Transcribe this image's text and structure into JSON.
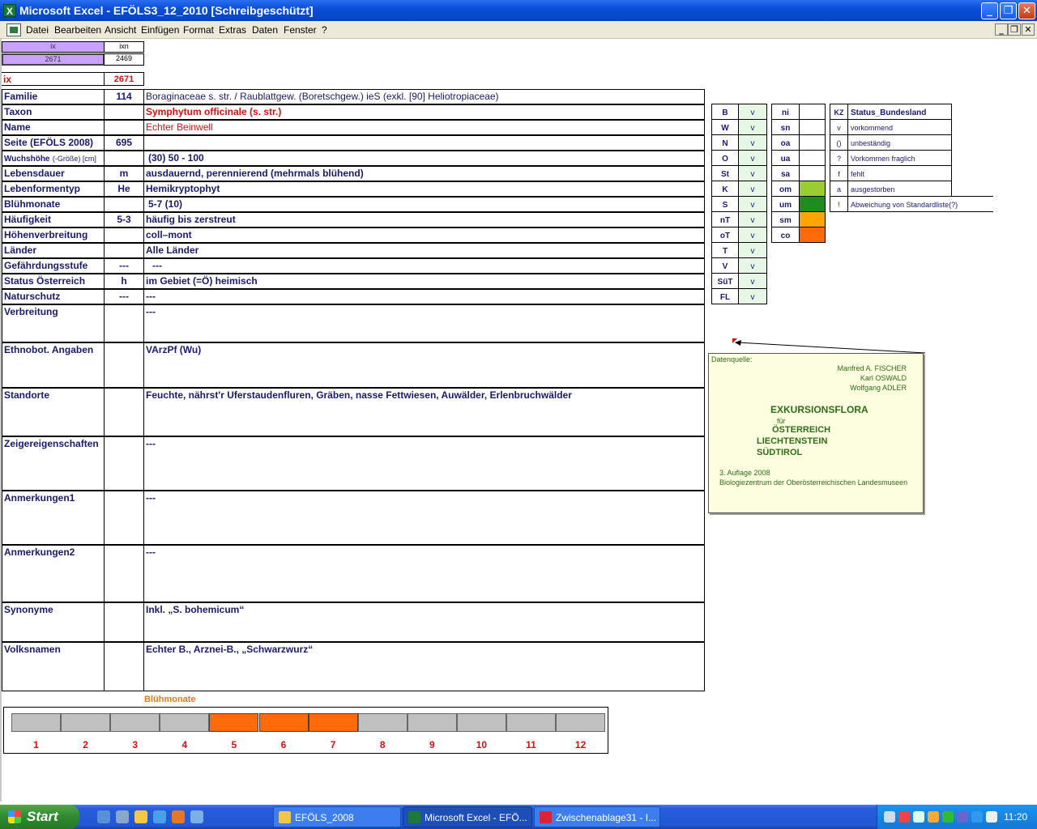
{
  "window": {
    "title": "Microsoft Excel - EFÖLS3_12_2010  [Schreibgeschützt]",
    "app_icon": "excel-icon",
    "btn_minimize": "_",
    "btn_restore": "❐",
    "btn_close": "✕"
  },
  "menu": {
    "items": [
      "Datei",
      "Bearbeiten",
      "Ansicht",
      "Einfügen",
      "Format",
      "Extras",
      "Daten",
      "Fenster",
      "?"
    ],
    "mdi_minimize": "_",
    "mdi_restore": "❐",
    "mdi_close": "✕"
  },
  "header_cells": {
    "ix_label": "ix",
    "ixn_label": "ixn",
    "ix_value": "2671",
    "ixn_value": "2469",
    "ix_big_label": "ix",
    "ix_big_value": "2671"
  },
  "fields": [
    {
      "label": "Familie",
      "code": "114",
      "value": "Boraginaceae s. str.  /  Raublattgew. (Boretschgew.) ieS (exkl. [90] Heliotropiaceae)"
    },
    {
      "label": "Taxon",
      "code": "",
      "value": "Symphytum officinale (s. str.)"
    },
    {
      "label": "Name",
      "code": "",
      "value": "Echter Beinwell"
    },
    {
      "label": "Seite (EFÖLS 2008)",
      "code": "695",
      "value": ""
    },
    {
      "label": "Wuchshöhe",
      "label_suffix": "(-Größe) [cm]",
      "code": "",
      "value": "(30) 50 - 100"
    },
    {
      "label": "Lebensdauer",
      "code": "m",
      "value": "ausdauernd, perennierend (mehrmals blühend)"
    },
    {
      "label": "Lebenformentyp",
      "code": "He",
      "value": "Hemikryptophyt"
    },
    {
      "label": "Blühmonate",
      "code": "",
      "value": "5-7 (10)"
    },
    {
      "label": "Häufigkeit",
      "code": "5-3",
      "value": "häufig bis zerstreut"
    },
    {
      "label": "Höhenverbreitung",
      "code": "",
      "value": "coll–mont"
    },
    {
      "label": "Länder",
      "code": "",
      "value": "Alle Länder"
    },
    {
      "label": "Gefährdungsstufe",
      "code": "---",
      "value": "---"
    },
    {
      "label": "Status Österreich",
      "code": "h",
      "value": "im Gebiet (=Ö) heimisch"
    },
    {
      "label": "Naturschutz",
      "code": "---",
      "value": "---"
    },
    {
      "label": "Verbreitung",
      "code": "",
      "value": "---"
    },
    {
      "label": "Ethnobot. Angaben",
      "code": "",
      "value": "VArzPf (Wu)"
    },
    {
      "label": "Standorte",
      "code": "",
      "value": "Feuchte, nährst'r Uferstaudenfluren, Gräben, nasse Fettwiesen, Auwälder, Erlenbruchwälder"
    },
    {
      "label": "Zeigereigenschaften",
      "code": "",
      "value": "---"
    },
    {
      "label": "Anmerkungen1",
      "code": "",
      "value": "---"
    },
    {
      "label": "Anmerkungen2",
      "code": "",
      "value": "---"
    },
    {
      "label": "Synonyme",
      "code": "",
      "value": "Inkl. „S. bohemicum“"
    },
    {
      "label": "Volksnamen",
      "code": "",
      "value": "Echter B., Arznei-B., „Schwarzwurz“"
    }
  ],
  "lands": [
    {
      "code": "B",
      "mark": "v"
    },
    {
      "code": "W",
      "mark": "v"
    },
    {
      "code": "N",
      "mark": "v"
    },
    {
      "code": "O",
      "mark": "v"
    },
    {
      "code": "St",
      "mark": "v"
    },
    {
      "code": "K",
      "mark": "v"
    },
    {
      "code": "S",
      "mark": "v"
    },
    {
      "code": "nT",
      "mark": "v"
    },
    {
      "code": "oT",
      "mark": "v"
    },
    {
      "code": "T",
      "mark": "v"
    },
    {
      "code": "V",
      "mark": "v"
    },
    {
      "code": "SüT",
      "mark": "v"
    },
    {
      "code": "FL",
      "mark": "v"
    }
  ],
  "zones": [
    {
      "code": "ni",
      "color": ""
    },
    {
      "code": "sn",
      "color": ""
    },
    {
      "code": "oa",
      "color": ""
    },
    {
      "code": "ua",
      "color": ""
    },
    {
      "code": "sa",
      "color": ""
    },
    {
      "code": "om",
      "color": "#9acd32"
    },
    {
      "code": "um",
      "color": "#1e8c1e"
    },
    {
      "code": "sm",
      "color": "#ffa500"
    },
    {
      "code": "co",
      "color": "#ff6a0a"
    }
  ],
  "status_legend": {
    "kz_header": "KZ",
    "status_header": "Status_Bundesland",
    "rows": [
      {
        "kz": "v",
        "text": "vorkommend"
      },
      {
        "kz": "()",
        "text": "unbeständig"
      },
      {
        "kz": "?",
        "text": "Vorkommen fraglich"
      },
      {
        "kz": "f",
        "text": "fehlt"
      },
      {
        "kz": "a",
        "text": "ausgestorben"
      },
      {
        "kz": "!",
        "text": "Abweichung von Standardliste(?)"
      }
    ]
  },
  "comment": {
    "source_label": "Datenquelle:",
    "author1": "Manfred A. FISCHER",
    "author2": "Karl OSWALD",
    "author3": "Wolfgang ADLER",
    "book_title": "EXKURSIONSFLORA",
    "fuer": "für",
    "country1": "ÖSTERREICH",
    "country2": "LIECHTENSTEIN",
    "country3": "SÜDTIROL",
    "edition": "3. Auflage 2008",
    "publisher": "Biologiezentrum der Oberösterreichischen Landesmuseen"
  },
  "bloom_chart": {
    "title": "Blühmonate",
    "months": [
      "1",
      "2",
      "3",
      "4",
      "5",
      "6",
      "7",
      "8",
      "9",
      "10",
      "11",
      "12"
    ],
    "active": [
      5,
      6,
      7
    ],
    "on_color": "#ff6a0a",
    "off_color": "#c0c0c0"
  },
  "taskbar": {
    "start_label": "Start",
    "tasks": [
      {
        "label": "EFÖLS_2008",
        "icon": "folder-icon",
        "active": false
      },
      {
        "label": "Microsoft Excel - EFÖ...",
        "icon": "excel-icon",
        "active": true
      },
      {
        "label": "Zwischenablage31 - I...",
        "icon": "irfanview-icon",
        "active": false
      }
    ],
    "clock": "11:20"
  }
}
